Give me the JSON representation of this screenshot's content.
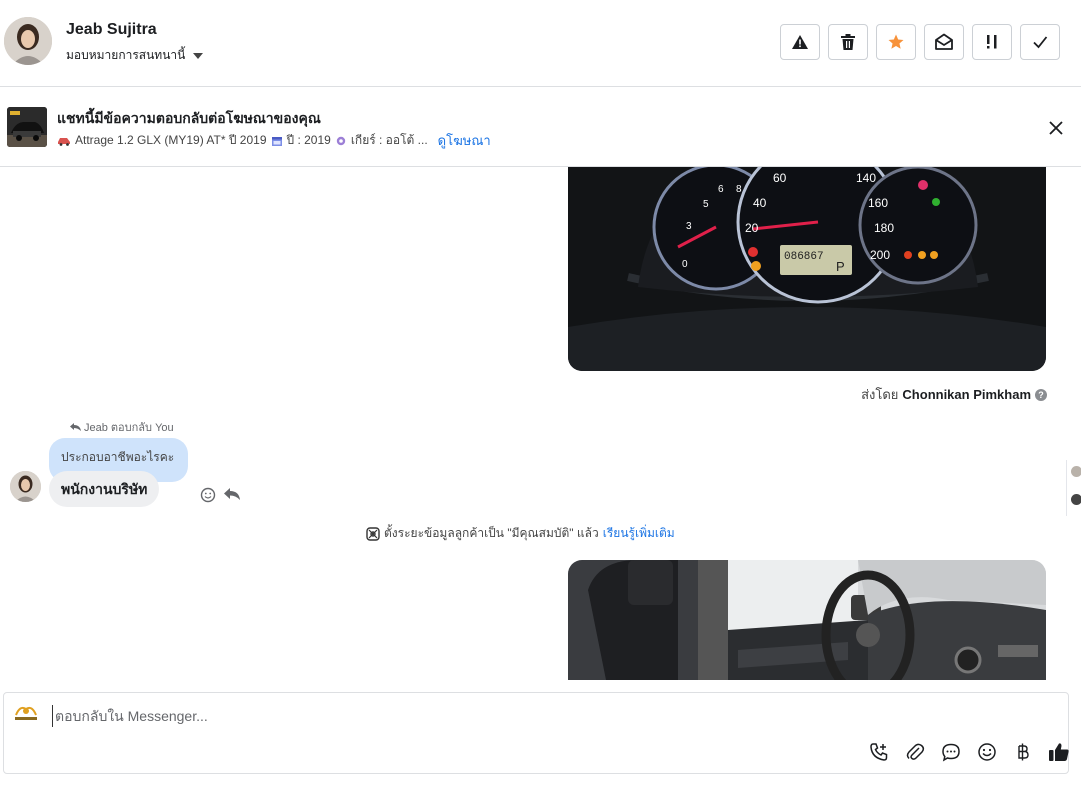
{
  "header": {
    "contact_name": "Jeab Sujitra",
    "assign_label": "มอบหมายการสนทนานี้",
    "actions": [
      {
        "name": "warning-icon",
        "label": "spam"
      },
      {
        "name": "trash-icon",
        "label": "delete"
      },
      {
        "name": "star-icon",
        "label": "follow up"
      },
      {
        "name": "envelope-open-icon",
        "label": "mark unread"
      },
      {
        "name": "priority-icon",
        "label": "priority"
      },
      {
        "name": "check-icon",
        "label": "done"
      }
    ],
    "star_color": "#f7923a"
  },
  "ad": {
    "title": "แชทนี้มีข้อความตอบกลับต่อโฆษณาของคุณ",
    "model": "Attrage 1.2 GLX (MY19) AT* ปี 2019",
    "year": "ปี : 2019",
    "gear": "เกียร์ : ออโต้ ...",
    "view_link": "ดูโฆษณา"
  },
  "thread": {
    "sent_by_prefix": "ส่งโดย",
    "sent_by_name": "Chonnikan Pimkham",
    "reply_note": "Jeab ตอบกลับ You",
    "quoted_text": "ประกอบอาชีพอะไรคะ",
    "message_text": "พนักงานบริษัท",
    "system_note": "ตั้งระยะข้อมูลลูกค้าเป็น \"มีคุณสมบัติ\" แล้ว",
    "system_link": "เรียนรู้เพิ่มเติม"
  },
  "composer": {
    "placeholder": "ตอบกลับใน Messenger...",
    "tools": [
      "call-add-icon",
      "paperclip-icon",
      "chat-bubble-icon",
      "emoji-icon",
      "baht-icon",
      "thumbs-up-icon"
    ]
  },
  "colors": {
    "accent": "#1b74e4",
    "quoted_bg": "#cfe3fb",
    "bubble_bg": "#eeeff1"
  }
}
